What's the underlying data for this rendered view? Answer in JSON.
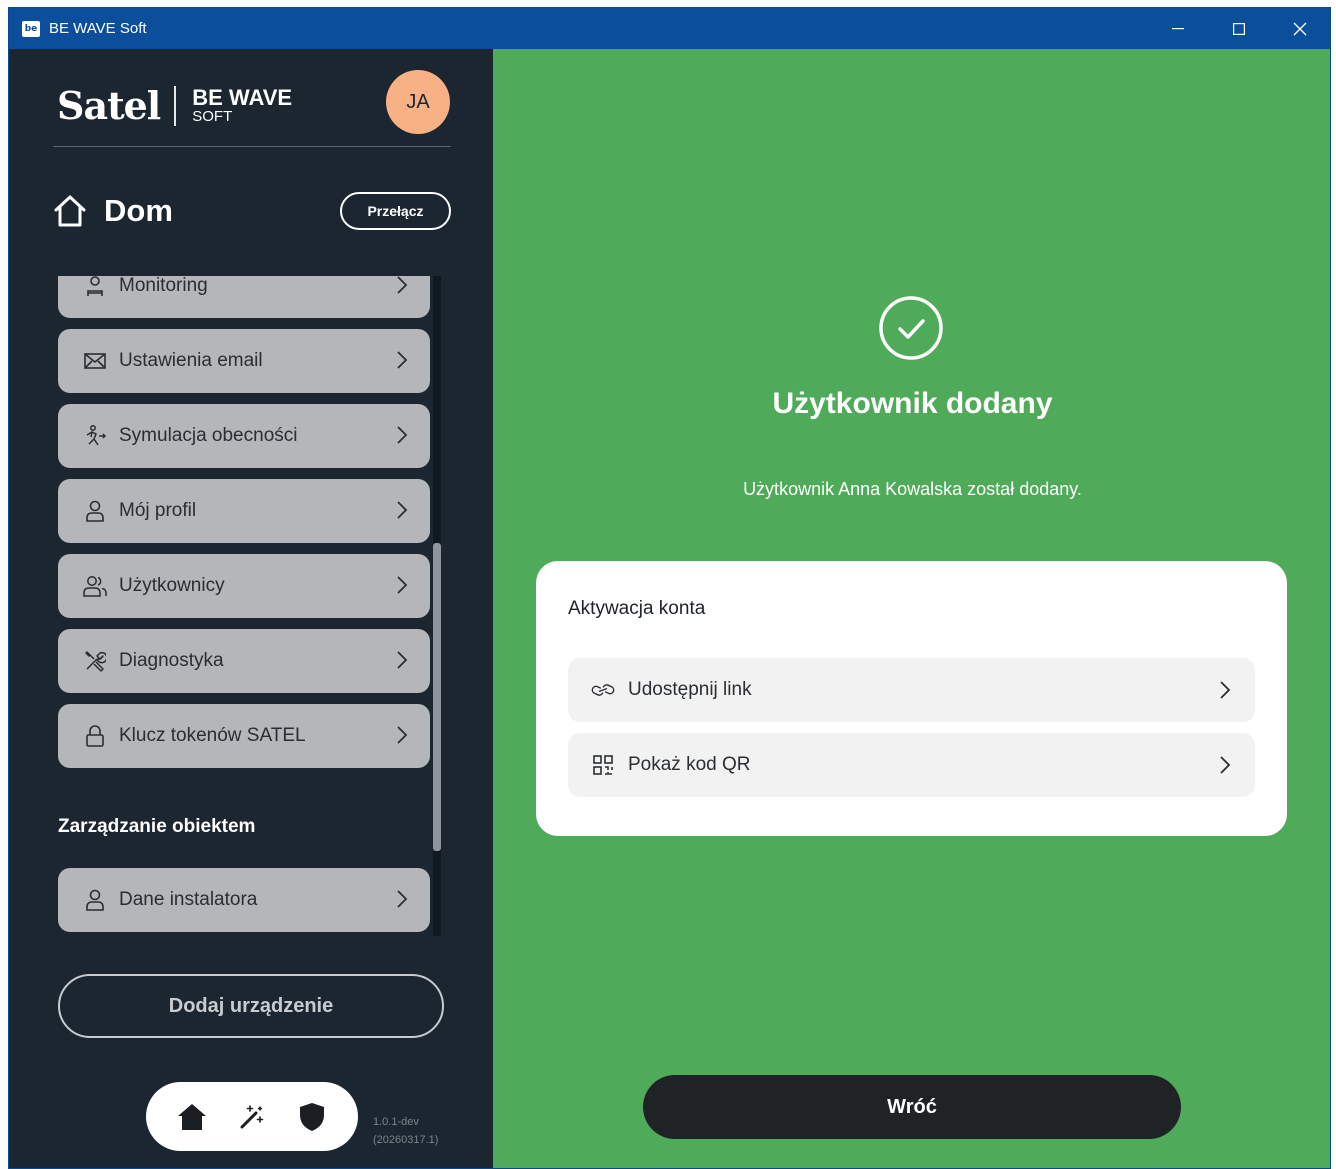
{
  "window": {
    "title": "BE WAVE Soft",
    "app_icon_text": "be",
    "controls": {
      "minimize": "—",
      "maximize": "☐",
      "close": "✕"
    }
  },
  "sidebar": {
    "logo": {
      "brand": "Satel",
      "product_line1": "BE WAVE",
      "product_line2": "SOFT"
    },
    "avatar_initials": "JA",
    "home_name": "Dom",
    "switch_label": "Przełącz",
    "menu_items": [
      {
        "label": "Monitoring",
        "icon": "monitoring-icon"
      },
      {
        "label": "Ustawienia email",
        "icon": "email-icon"
      },
      {
        "label": "Symulacja obecności",
        "icon": "presence-simulation-icon"
      },
      {
        "label": "Mój profil",
        "icon": "user-icon"
      },
      {
        "label": "Użytkownicy",
        "icon": "users-icon"
      },
      {
        "label": "Diagnostyka",
        "icon": "tools-icon"
      },
      {
        "label": "Klucz tokenów SATEL",
        "icon": "lock-icon"
      }
    ],
    "section_title": "Zarządzanie obiektem",
    "section_items": [
      {
        "label": "Dane instalatora",
        "icon": "user-icon"
      }
    ],
    "add_device_label": "Dodaj urządzenie",
    "bottom_nav": [
      "home-icon",
      "magic-wand-icon",
      "shield-icon"
    ],
    "version_line1": "1.0.1-dev",
    "version_line2": "(20260317.1)"
  },
  "main": {
    "title": "Użytkownik dodany",
    "message": "Użytkownik Anna Kowalska został dodany.",
    "card": {
      "title": "Aktywacja konta",
      "rows": [
        {
          "label": "Udostępnij link",
          "icon": "link-icon"
        },
        {
          "label": "Pokaż kod QR",
          "icon": "qr-code-icon"
        }
      ]
    },
    "back_label": "Wróć"
  },
  "colors": {
    "titlebar": "#0b4f9c",
    "sidebar_bg": "#1b2631",
    "main_bg": "#4faa5a",
    "menu_item_bg": "#b4b6b9",
    "avatar_bg": "#f7b184",
    "back_button_bg": "#202325"
  }
}
